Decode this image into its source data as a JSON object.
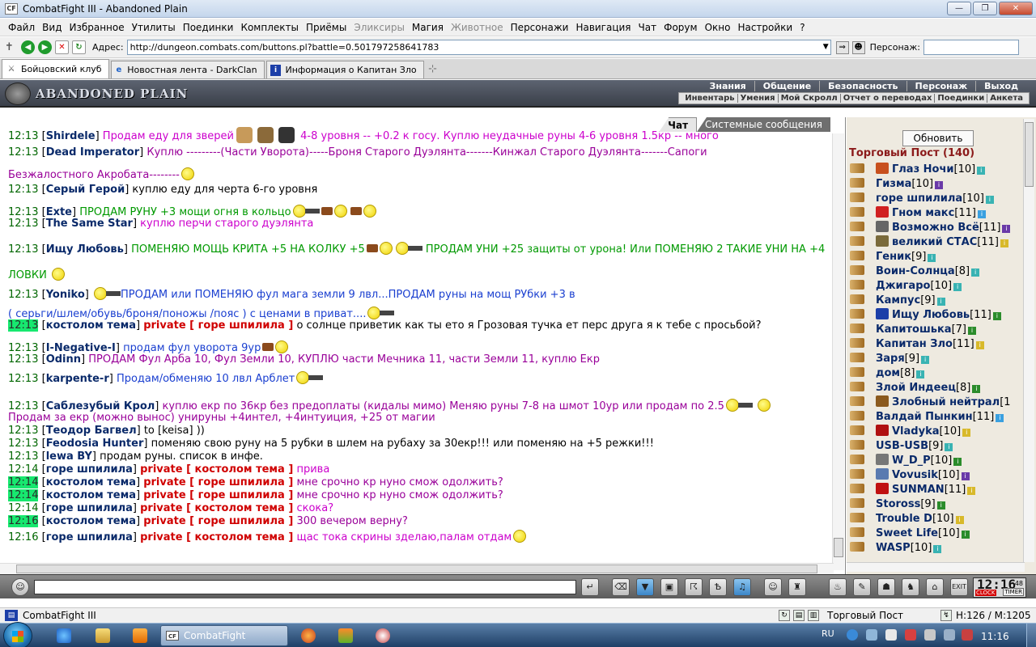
{
  "window": {
    "title": "CombatFight III - Abandoned Plain",
    "app_icon": "CF",
    "min": "—",
    "max": "❐",
    "close": "✕"
  },
  "menu": [
    "Файл",
    "Вид",
    "Избранное",
    "Утилиты",
    "Поединки",
    "Комплекты",
    "Приёмы",
    "Эликсиры",
    "Магия",
    "Животное",
    "Персонажи",
    "Навигация",
    "Чат",
    "Форум",
    "Окно",
    "Настройки",
    "?"
  ],
  "address": {
    "label": "Адрес:",
    "url": "http://dungeon.combats.com/buttons.pl?battle=0.501797258641783",
    "persona_label": "Персонаж:"
  },
  "tabs": [
    {
      "label": "Бойцовский клуб",
      "icon": "sword-icon"
    },
    {
      "label": "Новостная лента - DarkClan",
      "icon": "ie-icon"
    },
    {
      "label": "Информация о Капитан Зло",
      "icon": "info-icon"
    }
  ],
  "game": {
    "logo": "ABANDONED PLAIN",
    "topnav": [
      "Знания",
      "Общение",
      "Безопасность",
      "Персонаж",
      "Выход"
    ],
    "subnav": [
      "Инвентарь",
      "Умения",
      "Мой Скролл",
      "Отчет о переводах",
      "Поединки",
      "Анкета"
    ]
  },
  "chat": {
    "tab_chat": "Чат",
    "tab_system": "Системные сообщения",
    "lines": [
      {
        "time": "12:13",
        "nick": "Shirdele",
        "text": "Продам еду для зверей",
        "text2": "4-8 уровня -- +0.2 к госу. Куплю неудачные руны 4-6 уровня 1.5кр -- много",
        "cls": "mp"
      },
      {
        "time": "12:13",
        "nick": "Dead Imperator",
        "text": "Куплю ---------(Части Уворота)-----Броня Старого Дуэлянта-------Кинжал Старого Дуэлянта-------Сапоги",
        "cls": "mpu"
      },
      {
        "text": "Безжалостного Акробата--------",
        "cls": "mpu"
      },
      {
        "time": "12:13",
        "nick": "Серый Герой",
        "text": "куплю еду для черта 6-го уровня",
        "cls": "mk"
      },
      {
        "time": "12:13",
        "nick": "Exte",
        "text": "ПРОДАМ РУНУ +3 мощи огня в кольцо",
        "cls": "mg"
      },
      {
        "time": "12:13",
        "nick": "The Same Star",
        "text": "куплю перчи старого дуэлянта",
        "cls": "mp"
      },
      {
        "time": "12:13",
        "nick": "Ищу Любовь",
        "text": "ПОМЕНЯЮ МОЩЬ КРИТА +5 НА КОЛКУ +5",
        "text2": "ПРОДАМ УНИ +25 защиты от урона! Или ПОМЕНЯЮ 2 ТАКИЕ УНИ НА +4",
        "cls": "mg"
      },
      {
        "text": "ЛОВКИ",
        "cls": "mg"
      },
      {
        "time": "12:13",
        "nick": "Yoniko",
        "text": "ПРОДАМ или ПОМЕНЯЮ фул мага земли 9 лвл...ПРОДАМ руны на мощ РУбки +3 в",
        "cls": "mb"
      },
      {
        "text": "( серьги/шлем/обувь/броня/поножы /пояс ) с ценами в приват....",
        "cls": "mb"
      },
      {
        "time": "12:13",
        "nick": "костолом тема",
        "private": "private [ горе шпилила ]",
        "text": "о солнце приветик как ты ето я Грозовая тучка ет перс друга я к тебе с просьбой?",
        "cls": "mk",
        "hl": true
      },
      {
        "time": "12:13",
        "nick": "I-Negative-I",
        "text": "продам фул уворота 9ур",
        "cls": "mb"
      },
      {
        "time": "12:13",
        "nick": "Odinn",
        "text": "ПРОДАМ Фул Арба 10, Фул Земли 10, КУПЛЮ части Мечника 11, части Земли 11, куплю Екр",
        "cls": "mpu"
      },
      {
        "time": "12:13",
        "nick": "karpente-r",
        "text": "Продам/обменяю 10 лвл Арблет",
        "cls": "mb"
      },
      {
        "time": "12:13",
        "nick": "Саблезубый Крол",
        "text": "куплю екр по 36кр без предоплаты (кидалы мимо) Меняю руны 7-8 на шмот 10ур или продам по 2.5",
        "cls": "mpu"
      },
      {
        "text": "Продам за екр (можно вынос) унируны +4интел, +4интуиция, +25 от магии",
        "cls": "mpu"
      },
      {
        "time": "12:13",
        "nick": "Теодор Багвел",
        "text": "to [keisa] ))",
        "cls": "mk"
      },
      {
        "time": "12:13",
        "nick": "Feodosia Hunter",
        "text": "поменяю свою руну на 5 рубки в шлем на рубаху за 30екр!!! или поменяю на +5 режки!!!",
        "cls": "mk"
      },
      {
        "time": "12:13",
        "nick": "lewa BY",
        "text": "продам руны. список в инфе.",
        "cls": "mk"
      },
      {
        "time": "12:14",
        "nick": "горе шпилила",
        "private": "private [ костолом тема ]",
        "text": "прива",
        "cls": "mp"
      },
      {
        "time": "12:14",
        "nick": "костолом тема",
        "private": "private [ горе шпилила ]",
        "text": "мне срочно кр нуно смож одолжить?",
        "cls": "mpu",
        "hl": true
      },
      {
        "time": "12:14",
        "nick": "костолом тема",
        "private": "private [ горе шпилила ]",
        "text": "мне срочно кр нуно смож одолжить?",
        "cls": "mpu",
        "hl": true
      },
      {
        "time": "12:14",
        "nick": "горе шпилила",
        "private": "private [ костолом тема ]",
        "text": "скока?",
        "cls": "mp"
      },
      {
        "time": "12:16",
        "nick": "костолом тема",
        "private": "private [ горе шпилила ]",
        "text": "300 вечером верну?",
        "cls": "mpu",
        "hl": true
      },
      {
        "time": "12:16",
        "nick": "горе шпилила",
        "private": "private [ костолом тема ]",
        "text": "щас тока скрины зделаю,палам отдам",
        "cls": "mp"
      }
    ]
  },
  "post": {
    "refresh": "Обновить",
    "title": "Торговый Пост (140)",
    "players": [
      {
        "name": "Глаз Ночи",
        "lvl": "[10]",
        "badge": "t",
        "clan": "#c8501e"
      },
      {
        "name": "Гизма",
        "lvl": "[10]",
        "badge": "p",
        "clan": ""
      },
      {
        "name": "горе шпилила",
        "lvl": "[10]",
        "badge": "t",
        "clan": ""
      },
      {
        "name": "Гном макс",
        "lvl": "[11]",
        "badge": "b",
        "clan": "#d02020"
      },
      {
        "name": "Возможно Всё",
        "lvl": "[11]",
        "badge": "p",
        "clan": "#666"
      },
      {
        "name": "великий СТАС",
        "lvl": "[11]",
        "badge": "y",
        "clan": "#7a6a3a"
      },
      {
        "name": "Геник",
        "lvl": "[9]",
        "badge": "t",
        "clan": ""
      },
      {
        "name": "Воин-Солнца",
        "lvl": "[8]",
        "badge": "t",
        "clan": ""
      },
      {
        "name": "Джигаро",
        "lvl": "[10]",
        "badge": "t",
        "clan": ""
      },
      {
        "name": "Кампус",
        "lvl": "[9]",
        "badge": "t",
        "clan": ""
      },
      {
        "name": "Ищу Любовь",
        "lvl": "[11]",
        "badge": "g",
        "clan": "#1c3fa8"
      },
      {
        "name": "Капитошька",
        "lvl": "[7]",
        "badge": "g",
        "clan": ""
      },
      {
        "name": "Капитан Зло",
        "lvl": "[11]",
        "badge": "y",
        "clan": ""
      },
      {
        "name": "Заря",
        "lvl": "[9]",
        "badge": "t",
        "clan": ""
      },
      {
        "name": "дом",
        "lvl": "[8]",
        "badge": "t",
        "clan": ""
      },
      {
        "name": "Злой Индеец",
        "lvl": "[8]",
        "badge": "g",
        "clan": ""
      },
      {
        "name": "Злобный нейтрал",
        "lvl": "[1",
        "badge": "",
        "clan": "#8b5a1e"
      },
      {
        "name": "Валдай Пынкин",
        "lvl": "[11]",
        "badge": "b",
        "clan": ""
      },
      {
        "name": "Vladyka",
        "lvl": "[10]",
        "badge": "y",
        "clan": "#b01010"
      },
      {
        "name": "USB-USB",
        "lvl": "[9]",
        "badge": "t",
        "clan": ""
      },
      {
        "name": "W_D_P",
        "lvl": "[10]",
        "badge": "g",
        "clan": "#777"
      },
      {
        "name": "Vovusik",
        "lvl": "[10]",
        "badge": "p",
        "clan": "#5a7ab0"
      },
      {
        "name": "SUNMAN",
        "lvl": "[11]",
        "badge": "y",
        "clan": "#c01010"
      },
      {
        "name": "Stoross",
        "lvl": "[9]",
        "badge": "g",
        "clan": ""
      },
      {
        "name": "Trouble D",
        "lvl": "[10]",
        "badge": "y",
        "clan": ""
      },
      {
        "name": "Sweet Life",
        "lvl": "[10]",
        "badge": "g",
        "clan": ""
      },
      {
        "name": "WASP",
        "lvl": "[10]",
        "badge": "t",
        "clan": ""
      }
    ]
  },
  "clock": {
    "time": "12:16",
    "sec": "48",
    "l1": "CLOCK",
    "l2": "TIMER"
  },
  "status": {
    "left": "CombatFight III",
    "place": "Торговый Пост",
    "hm": "H:126 / M:1205"
  },
  "taskbar": {
    "task": "CombatFight",
    "lang": "RU",
    "time": "11:16"
  }
}
